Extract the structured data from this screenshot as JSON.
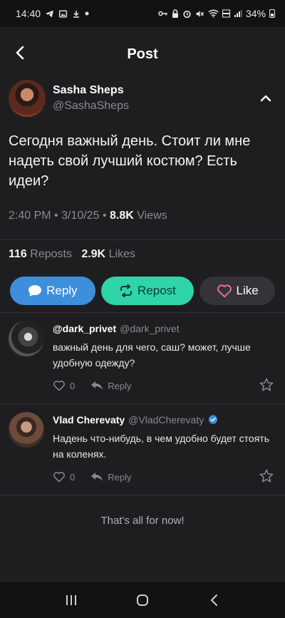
{
  "status_bar": {
    "time": "14:40",
    "battery": "34%",
    "left_icons": [
      "telegram-icon",
      "gallery-icon",
      "download-icon",
      "dot-icon"
    ],
    "right_icons": [
      "key-icon",
      "lock-icon",
      "alarm-icon",
      "mute-icon",
      "wifi-icon",
      "lte-icon",
      "signal-icon",
      "battery-icon"
    ]
  },
  "header": {
    "title": "Post"
  },
  "post": {
    "author_name": "Sasha Sheps",
    "author_handle": "@SashaSheps",
    "text": "Сегодня важный день. Стоит ли мне надеть свой лучший костюм? Есть идеи?",
    "time": "2:40 PM",
    "date": "3/10/25",
    "views_count": "8.8K",
    "views_label": "Views",
    "reposts_count": "116",
    "reposts_label": "Reposts",
    "likes_count": "2.9K",
    "likes_label": "Likes"
  },
  "actions": {
    "reply": "Reply",
    "repost": "Repost",
    "like": "Like"
  },
  "comments": [
    {
      "name": "@dark_privet",
      "handle": "@dark_privet",
      "verified": false,
      "text": "важный день для чего, саш? может, лучше удобную одежду?",
      "likes": "0",
      "reply_label": "Reply"
    },
    {
      "name": "Vlad Cherevaty",
      "handle": "@VladCherevaty",
      "verified": true,
      "text": "Надень что-нибудь, в чем удобно будет стоять на коленях.",
      "likes": "0",
      "reply_label": "Reply"
    }
  ],
  "end_note": "That's all for now!",
  "colors": {
    "background": "#1e1e20",
    "reply_button": "#3d8edb",
    "repost_button": "#2fd4a8",
    "like_button": "#333338",
    "verified_badge": "#3d8edb"
  }
}
